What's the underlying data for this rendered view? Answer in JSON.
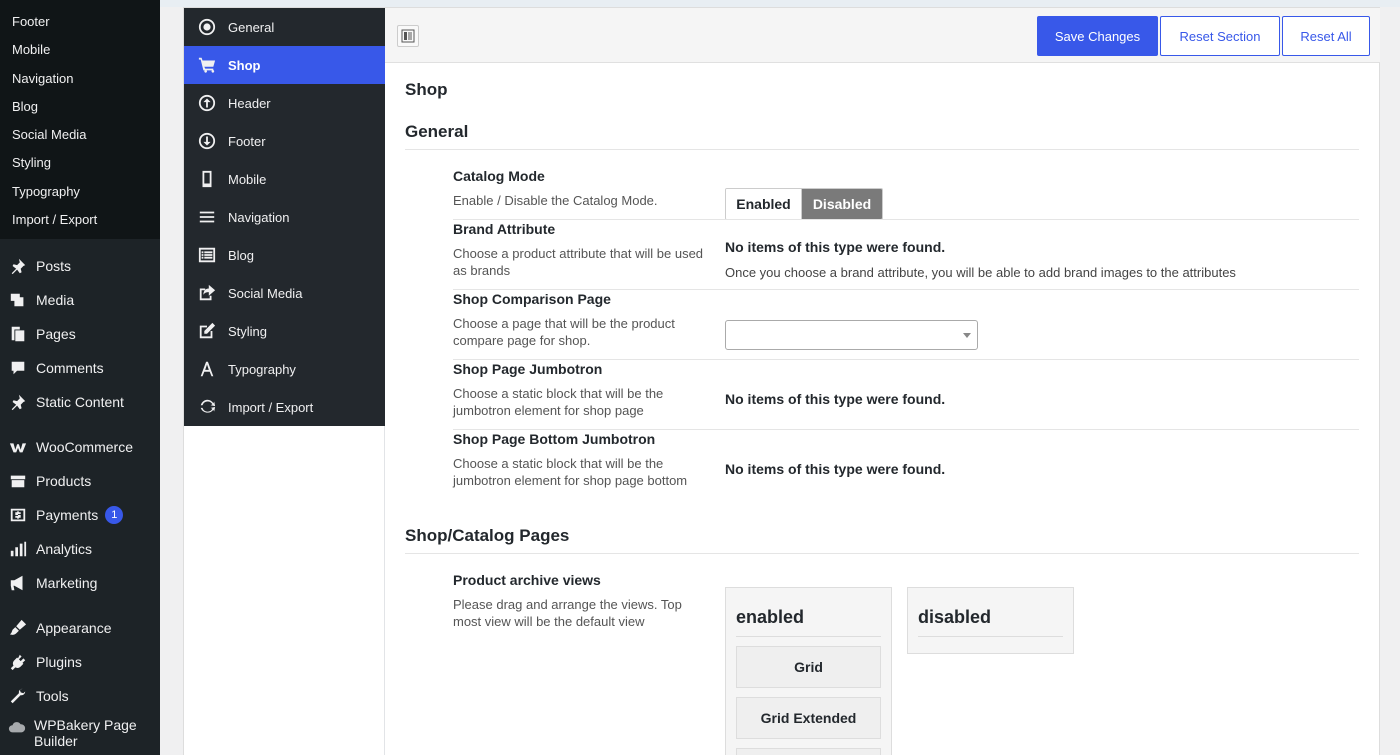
{
  "wp_submenu": [
    "Footer",
    "Mobile",
    "Navigation",
    "Blog",
    "Social Media",
    "Styling",
    "Typography",
    "Import / Export"
  ],
  "wp_menu": [
    {
      "label": "Posts",
      "icon": "pin-icon"
    },
    {
      "label": "Media",
      "icon": "media-icon"
    },
    {
      "label": "Pages",
      "icon": "pages-icon"
    },
    {
      "label": "Comments",
      "icon": "comments-icon"
    },
    {
      "label": "Static Content",
      "icon": "pin-icon"
    },
    {
      "label": "WooCommerce",
      "icon": "woocommerce-icon"
    },
    {
      "label": "Products",
      "icon": "archive-icon"
    },
    {
      "label": "Payments",
      "icon": "dollar-icon",
      "badge": "1"
    },
    {
      "label": "Analytics",
      "icon": "chart-bar-icon"
    },
    {
      "label": "Marketing",
      "icon": "megaphone-icon"
    },
    {
      "label": "Appearance",
      "icon": "brush-icon"
    },
    {
      "label": "Plugins",
      "icon": "plug-icon"
    },
    {
      "label": "Tools",
      "icon": "wrench-icon"
    },
    {
      "label": "WPBakery Page Builder",
      "icon": "cloud-icon"
    }
  ],
  "options_nav": [
    {
      "label": "General",
      "icon": "record-icon"
    },
    {
      "label": "Shop",
      "icon": "cart-icon",
      "active": true
    },
    {
      "label": "Header",
      "icon": "arrow-up-circle-icon"
    },
    {
      "label": "Footer",
      "icon": "arrow-down-circle-icon"
    },
    {
      "label": "Mobile",
      "icon": "phone-icon"
    },
    {
      "label": "Navigation",
      "icon": "menu-icon"
    },
    {
      "label": "Blog",
      "icon": "list-icon"
    },
    {
      "label": "Social Media",
      "icon": "share-icon"
    },
    {
      "label": "Styling",
      "icon": "edit-icon"
    },
    {
      "label": "Typography",
      "icon": "font-icon"
    },
    {
      "label": "Import / Export",
      "icon": "refresh-icon"
    }
  ],
  "header": {
    "save_label": "Save Changes",
    "reset_section_label": "Reset Section",
    "reset_all_label": "Reset All"
  },
  "content": {
    "page_title": "Shop",
    "general_title": "General",
    "catalog_mode": {
      "title": "Catalog Mode",
      "desc": "Enable / Disable the Catalog Mode.",
      "enabled_label": "Enabled",
      "disabled_label": "Disabled",
      "selected": "Disabled"
    },
    "brand_attribute": {
      "title": "Brand Attribute",
      "desc": "Choose a product attribute that will be used as brands",
      "value": "No items of this type were found.",
      "note": "Once you choose a brand attribute, you will be able to add brand images to the attributes"
    },
    "comparison_page": {
      "title": "Shop Comparison Page",
      "desc": "Choose a page that will be the product compare page for shop.",
      "value": ""
    },
    "jumbotron": {
      "title": "Shop Page Jumbotron",
      "desc": "Choose a static block that will be the jumbotron element for shop page",
      "value": "No items of this type were found."
    },
    "bottom_jumbotron": {
      "title": "Shop Page Bottom Jumbotron",
      "desc": "Choose a static block that will be the jumbotron element for shop page bottom",
      "value": "No items of this type were found."
    },
    "catalog_pages_title": "Shop/Catalog Pages",
    "archive_views": {
      "title": "Product archive views",
      "desc": "Please drag and arrange the views. Top most view will be the default view",
      "enabled_head": "enabled",
      "disabled_head": "disabled",
      "enabled_items": [
        "Grid",
        "Grid Extended"
      ]
    }
  },
  "colors": {
    "accent": "#3858e9",
    "admin_bg": "#1d2327",
    "submenu_bg": "#101517"
  }
}
